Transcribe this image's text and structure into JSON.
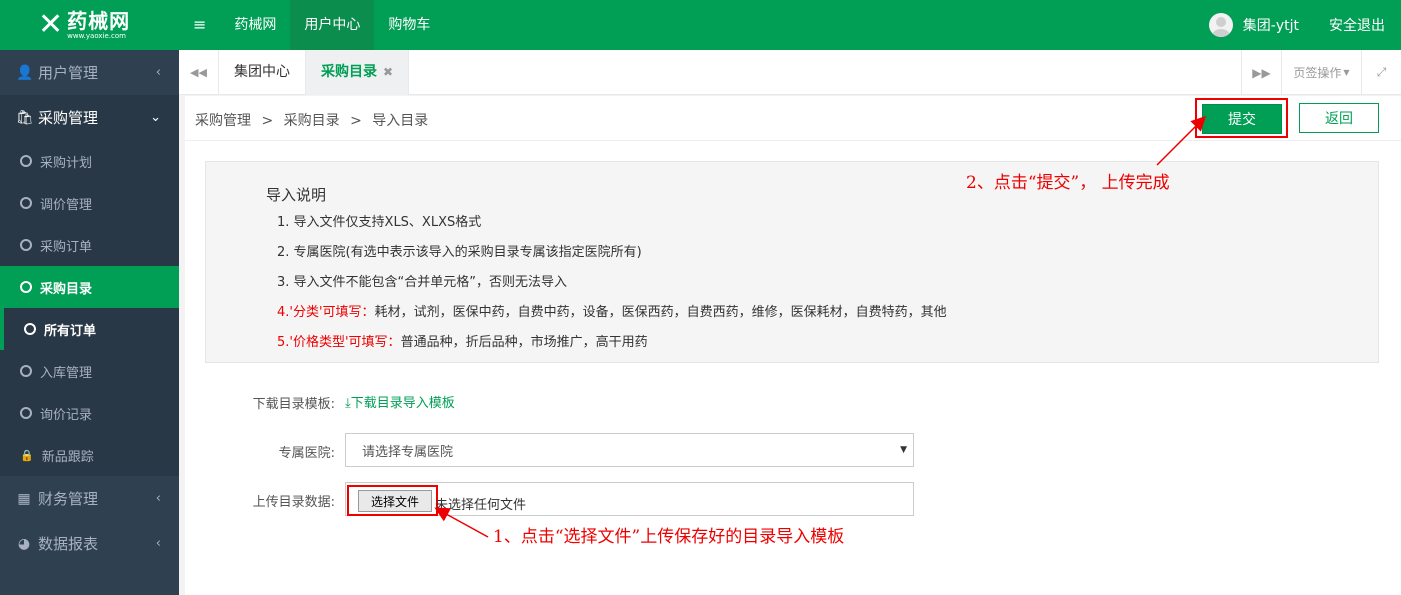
{
  "brand": {
    "name": "药械网",
    "url": "www.yaoxie.com"
  },
  "topnav": {
    "items": [
      "药械网",
      "用户中心",
      "购物车"
    ],
    "active": "用户中心"
  },
  "user": {
    "name": "集团-ytjt",
    "logout": "安全退出"
  },
  "sidebar": {
    "groups": [
      {
        "label": "用户管理"
      },
      {
        "label": "采购管理"
      },
      {
        "label": "财务管理"
      },
      {
        "label": "数据报表"
      }
    ],
    "sub_items": [
      "采购计划",
      "调价管理",
      "采购订单",
      "采购目录",
      "所有订单",
      "入库管理",
      "询价记录",
      "新品跟踪"
    ]
  },
  "tabs": {
    "items": [
      "集团中心",
      "采购目录"
    ],
    "page_ops": "页签操作"
  },
  "breadcrumb": {
    "l1": "采购管理",
    "l2": "采购目录",
    "l3": "导入目录",
    "sep": ">"
  },
  "actions": {
    "submit": "提交",
    "back": "返回"
  },
  "instructions": {
    "title": "导入说明",
    "line1": "1. 导入文件仅支持XLS、XLXS格式",
    "line2": "2. 专属医院(有选中表示该导入的采购目录专属该指定医院所有)",
    "line3": "3. 导入文件不能包含“合并单元格”，否则无法导入",
    "line4_prefix": "4.",
    "line4_red": "'分类'可填写：",
    "line4_text": "耗材，试剂，医保中药，自费中药，设备，医保西药，自费西药，维修，医保耗材，自费特药，其他",
    "line5_prefix": "5.",
    "line5_red": "'价格类型'可填写：",
    "line5_text": "普通品种，折后品种，市场推广，高干用药"
  },
  "form": {
    "template_label": "下载目录模板:",
    "template_link": "下载目录导入模板",
    "hospital_label": "专属医院:",
    "hospital_placeholder": "请选择专属医院",
    "upload_label": "上传目录数据:",
    "file_button": "选择文件",
    "file_none": "未选择任何文件"
  },
  "annotations": {
    "step2": "2、点击“提交”， 上传完成",
    "step1": "1、点击“选择文件”上传保存好的目录导入模板"
  },
  "colors": {
    "brand_green": "#009f55",
    "sidebar_bg": "#2f4050",
    "annotation_red": "#e00000"
  }
}
